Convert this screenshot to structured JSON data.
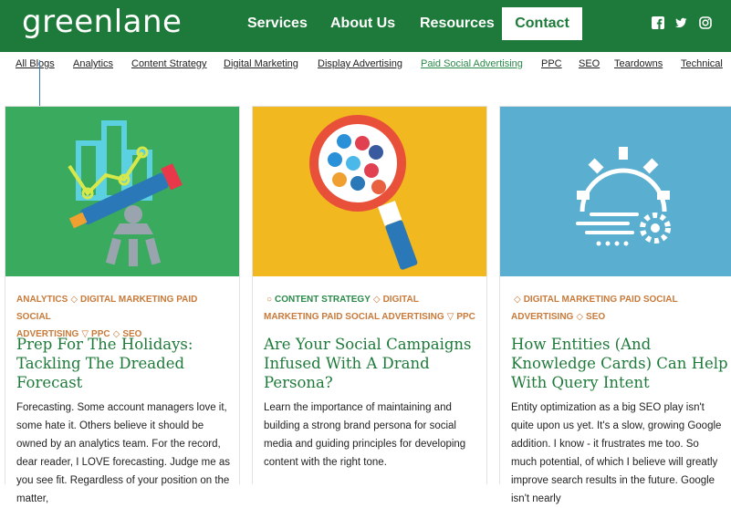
{
  "header": {
    "logo": "greenlane",
    "nav": [
      {
        "label": "Services"
      },
      {
        "label": "About Us"
      },
      {
        "label": "Resources"
      }
    ],
    "contact_label": "Contact",
    "social_icons": [
      "facebook-icon",
      "twitter-icon",
      "instagram-icon"
    ],
    "bg_color": "#1e7a3a"
  },
  "categories": [
    {
      "label": "All Blogs"
    },
    {
      "label": "Analytics"
    },
    {
      "label": "Content Strategy"
    },
    {
      "label": "Digital Marketing"
    },
    {
      "label": "Display Advertising"
    },
    {
      "label": "Paid Social Advertising",
      "active": true
    },
    {
      "label": "PPC"
    },
    {
      "label": "SEO"
    },
    {
      "label": "Teardowns"
    },
    {
      "label": "Technical"
    }
  ],
  "cards": [
    {
      "image": "analytics-telescope-illustration",
      "image_bg": "#3aaa5e",
      "tags_line1": [
        "Analytics",
        "Digital Marketing",
        "Paid Social"
      ],
      "tags_line2": [
        "Advertising",
        "PPC",
        "SEO"
      ],
      "title": "Prep For The Holidays: Tackling The Dreaded Forecast",
      "excerpt": "Forecasting. Some account managers love it, some hate it. Others believe it should be owned by an analytics team. For the record, dear reader, I LOVE forecasting. Judge me as you see fit. Regardless of your position on the matter,"
    },
    {
      "image": "social-magnifier-illustration",
      "image_bg": "#f2b820",
      "tags_line1": [
        "Content Strategy",
        "Digital"
      ],
      "tags_line2": [
        "Marketing",
        "Paid Social Advertising",
        "PPC"
      ],
      "title": "Are Your Social Campaigns Infused With A Drand Persona?",
      "excerpt": "Learn the importance of maintaining and building a strong brand persona for social media and guiding principles for developing content with the right tone."
    },
    {
      "image": "gear-cloud-illustration",
      "image_bg": "#5aaed0",
      "tags_line1": [
        "Digital Marketing",
        "Paid Social"
      ],
      "tags_line2": [
        "Advertising",
        "SEO"
      ],
      "title": "How Entities (And Knowledge Cards) Can Help With Query Intent",
      "excerpt": "Entity optimization as a big SEO play isn't quite upon us yet. It's a slow, growing Google addition. I know - it frustrates me too. So much potential, of which I believe will greatly improve search results in the future. Google isn't nearly"
    }
  ]
}
